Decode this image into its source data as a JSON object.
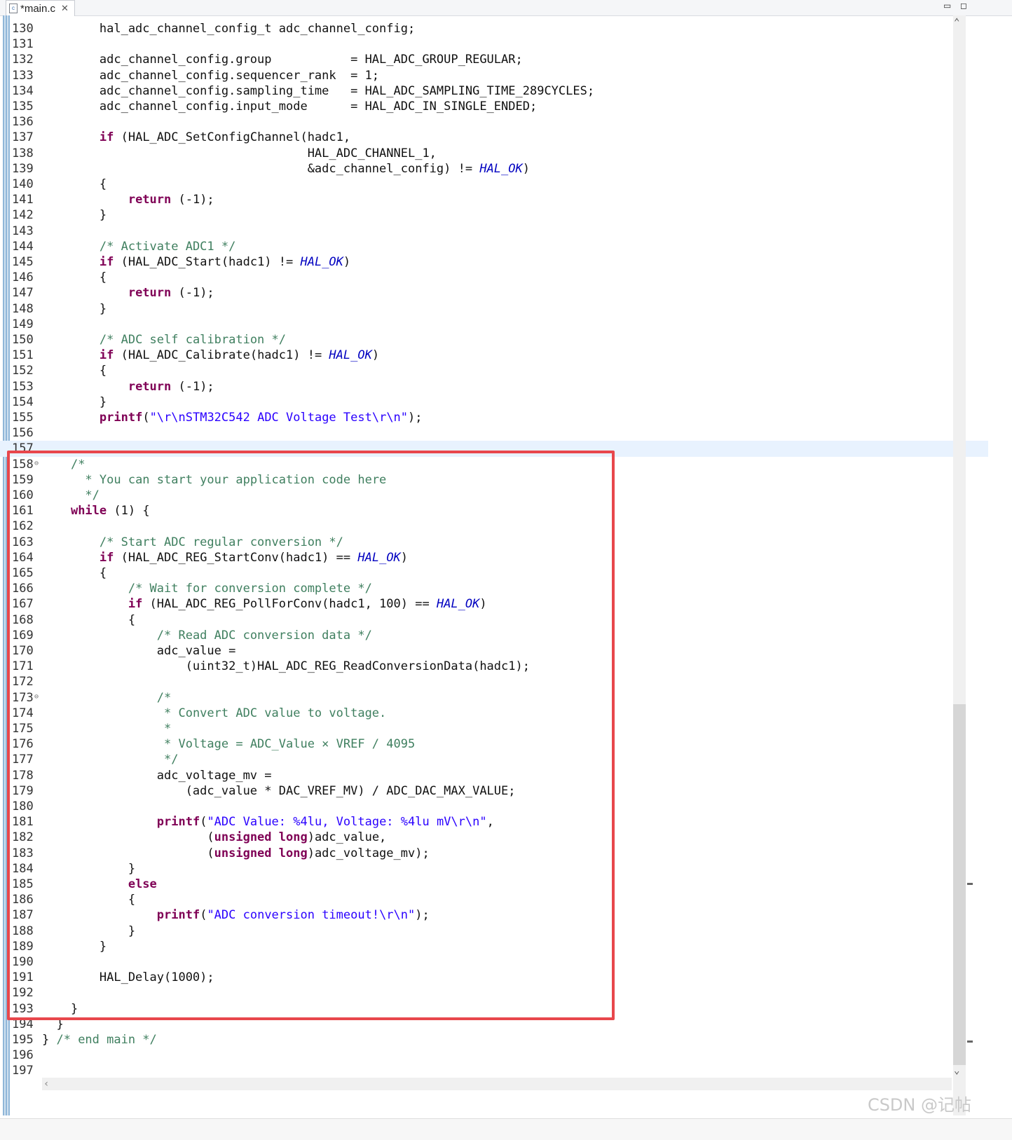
{
  "tab": {
    "title": "*main.c",
    "close_label": "✕"
  },
  "window_controls": {
    "minimize": "▭",
    "maximize": "◻"
  },
  "lines": [
    {
      "n": "130",
      "segs": [
        {
          "t": "        hal_adc_channel_config_t adc_channel_config;"
        }
      ]
    },
    {
      "n": "131",
      "segs": []
    },
    {
      "n": "132",
      "segs": [
        {
          "t": "        adc_channel_config.group           = HAL_ADC_GROUP_REGULAR;"
        }
      ]
    },
    {
      "n": "133",
      "segs": [
        {
          "t": "        adc_channel_config.sequencer_rank  = 1;"
        }
      ]
    },
    {
      "n": "134",
      "segs": [
        {
          "t": "        adc_channel_config.sampling_time   = HAL_ADC_SAMPLING_TIME_289CYCLES;"
        }
      ]
    },
    {
      "n": "135",
      "segs": [
        {
          "t": "        adc_channel_config.input_mode      = HAL_ADC_IN_SINGLE_ENDED;"
        }
      ]
    },
    {
      "n": "136",
      "segs": []
    },
    {
      "n": "137",
      "segs": [
        {
          "t": "        "
        },
        {
          "t": "if",
          "c": "kw"
        },
        {
          "t": " (HAL_ADC_SetConfigChannel(hadc1,"
        }
      ]
    },
    {
      "n": "138",
      "segs": [
        {
          "t": "                                     HAL_ADC_CHANNEL_1,"
        }
      ]
    },
    {
      "n": "139",
      "segs": [
        {
          "t": "                                     &adc_channel_config) != "
        },
        {
          "t": "HAL_OK",
          "c": "cn"
        },
        {
          "t": ")"
        }
      ]
    },
    {
      "n": "140",
      "segs": [
        {
          "t": "        {"
        }
      ]
    },
    {
      "n": "141",
      "segs": [
        {
          "t": "            "
        },
        {
          "t": "return",
          "c": "kw"
        },
        {
          "t": " (-1);"
        }
      ]
    },
    {
      "n": "142",
      "segs": [
        {
          "t": "        }"
        }
      ]
    },
    {
      "n": "143",
      "segs": []
    },
    {
      "n": "144",
      "segs": [
        {
          "t": "        "
        },
        {
          "t": "/* Activate ADC1 */",
          "c": "cm"
        }
      ]
    },
    {
      "n": "145",
      "segs": [
        {
          "t": "        "
        },
        {
          "t": "if",
          "c": "kw"
        },
        {
          "t": " (HAL_ADC_Start(hadc1) != "
        },
        {
          "t": "HAL_OK",
          "c": "cn"
        },
        {
          "t": ")"
        }
      ]
    },
    {
      "n": "146",
      "segs": [
        {
          "t": "        {"
        }
      ]
    },
    {
      "n": "147",
      "segs": [
        {
          "t": "            "
        },
        {
          "t": "return",
          "c": "kw"
        },
        {
          "t": " (-1);"
        }
      ]
    },
    {
      "n": "148",
      "segs": [
        {
          "t": "        }"
        }
      ]
    },
    {
      "n": "149",
      "segs": []
    },
    {
      "n": "150",
      "segs": [
        {
          "t": "        "
        },
        {
          "t": "/* ADC self calibration */",
          "c": "cm"
        }
      ]
    },
    {
      "n": "151",
      "segs": [
        {
          "t": "        "
        },
        {
          "t": "if",
          "c": "kw"
        },
        {
          "t": " (HAL_ADC_Calibrate(hadc1) != "
        },
        {
          "t": "HAL_OK",
          "c": "cn"
        },
        {
          "t": ")"
        }
      ]
    },
    {
      "n": "152",
      "segs": [
        {
          "t": "        {"
        }
      ]
    },
    {
      "n": "153",
      "segs": [
        {
          "t": "            "
        },
        {
          "t": "return",
          "c": "kw"
        },
        {
          "t": " (-1);"
        }
      ]
    },
    {
      "n": "154",
      "segs": [
        {
          "t": "        }"
        }
      ]
    },
    {
      "n": "155",
      "segs": [
        {
          "t": "        "
        },
        {
          "t": "printf",
          "c": "kw"
        },
        {
          "t": "("
        },
        {
          "t": "\"\\r\\nSTM32C542 ADC Voltage Test\\r\\n\"",
          "c": "st"
        },
        {
          "t": ");"
        }
      ]
    },
    {
      "n": "156",
      "segs": []
    },
    {
      "n": "157",
      "segs": [],
      "current": true
    },
    {
      "n": "158",
      "fold": "⊖",
      "segs": [
        {
          "t": "    "
        },
        {
          "t": "/*",
          "c": "cm"
        }
      ]
    },
    {
      "n": "159",
      "segs": [
        {
          "t": "      "
        },
        {
          "t": "* You can start your application code here",
          "c": "cm"
        }
      ]
    },
    {
      "n": "160",
      "segs": [
        {
          "t": "      "
        },
        {
          "t": "*/",
          "c": "cm"
        }
      ]
    },
    {
      "n": "161",
      "segs": [
        {
          "t": "    "
        },
        {
          "t": "while",
          "c": "kw"
        },
        {
          "t": " (1) {"
        }
      ]
    },
    {
      "n": "162",
      "segs": []
    },
    {
      "n": "163",
      "segs": [
        {
          "t": "        "
        },
        {
          "t": "/* Start ADC regular conversion */",
          "c": "cm"
        }
      ]
    },
    {
      "n": "164",
      "segs": [
        {
          "t": "        "
        },
        {
          "t": "if",
          "c": "kw"
        },
        {
          "t": " (HAL_ADC_REG_StartConv(hadc1) == "
        },
        {
          "t": "HAL_OK",
          "c": "cn"
        },
        {
          "t": ")"
        }
      ]
    },
    {
      "n": "165",
      "segs": [
        {
          "t": "        {"
        }
      ]
    },
    {
      "n": "166",
      "segs": [
        {
          "t": "            "
        },
        {
          "t": "/* Wait for conversion complete */",
          "c": "cm"
        }
      ]
    },
    {
      "n": "167",
      "segs": [
        {
          "t": "            "
        },
        {
          "t": "if",
          "c": "kw"
        },
        {
          "t": " (HAL_ADC_REG_PollForConv(hadc1, 100) == "
        },
        {
          "t": "HAL_OK",
          "c": "cn"
        },
        {
          "t": ")"
        }
      ]
    },
    {
      "n": "168",
      "segs": [
        {
          "t": "            {"
        }
      ]
    },
    {
      "n": "169",
      "segs": [
        {
          "t": "                "
        },
        {
          "t": "/* Read ADC conversion data */",
          "c": "cm"
        }
      ]
    },
    {
      "n": "170",
      "segs": [
        {
          "t": "                adc_value ="
        }
      ]
    },
    {
      "n": "171",
      "segs": [
        {
          "t": "                    (uint32_t)HAL_ADC_REG_ReadConversionData(hadc1);"
        }
      ]
    },
    {
      "n": "172",
      "segs": []
    },
    {
      "n": "173",
      "fold": "⊖",
      "segs": [
        {
          "t": "                "
        },
        {
          "t": "/*",
          "c": "cm"
        }
      ]
    },
    {
      "n": "174",
      "segs": [
        {
          "t": "                 "
        },
        {
          "t": "* Convert ADC value to voltage.",
          "c": "cm"
        }
      ]
    },
    {
      "n": "175",
      "segs": [
        {
          "t": "                 "
        },
        {
          "t": "*",
          "c": "cm"
        }
      ]
    },
    {
      "n": "176",
      "segs": [
        {
          "t": "                 "
        },
        {
          "t": "* Voltage = ADC_Value × VREF / 4095",
          "c": "cm"
        }
      ]
    },
    {
      "n": "177",
      "segs": [
        {
          "t": "                 "
        },
        {
          "t": "*/",
          "c": "cm"
        }
      ]
    },
    {
      "n": "178",
      "segs": [
        {
          "t": "                adc_voltage_mv ="
        }
      ]
    },
    {
      "n": "179",
      "segs": [
        {
          "t": "                    (adc_value * DAC_VREF_MV) / ADC_DAC_MAX_VALUE;"
        }
      ]
    },
    {
      "n": "180",
      "segs": []
    },
    {
      "n": "181",
      "segs": [
        {
          "t": "                "
        },
        {
          "t": "printf",
          "c": "kw"
        },
        {
          "t": "("
        },
        {
          "t": "\"ADC Value: %4lu, Voltage: %4lu mV\\r\\n\"",
          "c": "st"
        },
        {
          "t": ","
        }
      ]
    },
    {
      "n": "182",
      "segs": [
        {
          "t": "                       ("
        },
        {
          "t": "unsigned long",
          "c": "kw"
        },
        {
          "t": ")adc_value,"
        }
      ]
    },
    {
      "n": "183",
      "segs": [
        {
          "t": "                       ("
        },
        {
          "t": "unsigned long",
          "c": "kw"
        },
        {
          "t": ")adc_voltage_mv);"
        }
      ]
    },
    {
      "n": "184",
      "segs": [
        {
          "t": "            }"
        }
      ]
    },
    {
      "n": "185",
      "segs": [
        {
          "t": "            "
        },
        {
          "t": "else",
          "c": "kw"
        }
      ]
    },
    {
      "n": "186",
      "segs": [
        {
          "t": "            {"
        }
      ]
    },
    {
      "n": "187",
      "segs": [
        {
          "t": "                "
        },
        {
          "t": "printf",
          "c": "kw"
        },
        {
          "t": "("
        },
        {
          "t": "\"ADC conversion timeout!\\r\\n\"",
          "c": "st"
        },
        {
          "t": ");"
        }
      ]
    },
    {
      "n": "188",
      "segs": [
        {
          "t": "            }"
        }
      ]
    },
    {
      "n": "189",
      "segs": [
        {
          "t": "        }"
        }
      ]
    },
    {
      "n": "190",
      "segs": []
    },
    {
      "n": "191",
      "segs": [
        {
          "t": "        HAL_Delay(1000);"
        }
      ]
    },
    {
      "n": "192",
      "segs": []
    },
    {
      "n": "193",
      "segs": [
        {
          "t": "    }"
        }
      ]
    },
    {
      "n": "194",
      "segs": [
        {
          "t": "  }"
        }
      ]
    },
    {
      "n": "195",
      "segs": [
        {
          "t": "} "
        },
        {
          "t": "/* end main */",
          "c": "cm"
        }
      ]
    },
    {
      "n": "196",
      "segs": []
    },
    {
      "n": "197",
      "segs": []
    }
  ],
  "watermark": "CSDN @记帖",
  "colors": {
    "keyword": "#7f0055",
    "comment": "#3f7f5f",
    "string": "#2a00ff",
    "constant": "#0000c0",
    "highlight_box": "#e8474c",
    "current_line": "#e8f2fe"
  }
}
